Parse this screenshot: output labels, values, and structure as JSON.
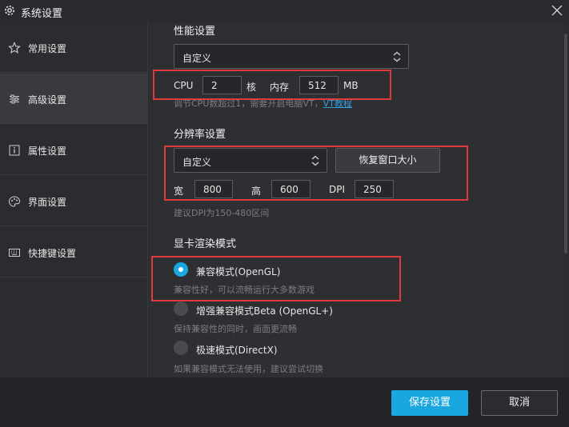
{
  "window": {
    "title": "系统设置"
  },
  "sidebar": {
    "items": [
      {
        "label": "常用设置",
        "icon": "star-icon"
      },
      {
        "label": "高级设置",
        "icon": "sliders-icon",
        "active": true
      },
      {
        "label": "属性设置",
        "icon": "info-icon"
      },
      {
        "label": "界面设置",
        "icon": "palette-icon"
      },
      {
        "label": "快捷键设置",
        "icon": "keyboard-icon"
      }
    ]
  },
  "performance": {
    "title": "性能设置",
    "mode": "自定义",
    "cpu_label": "CPU",
    "cpu_value": "2",
    "cpu_unit": "核",
    "mem_label": "内存",
    "mem_value": "512",
    "mem_unit": "MB",
    "hint": "调节CPU数超过1，需要开启电脑VT，",
    "hint_link": "VT教程"
  },
  "resolution": {
    "title": "分辨率设置",
    "mode": "自定义",
    "reset_button": "恢复窗口大小",
    "width_label": "宽",
    "width_value": "800",
    "height_label": "高",
    "height_value": "600",
    "dpi_label": "DPI",
    "dpi_value": "250",
    "hint": "建议DPI为150-480区间"
  },
  "render": {
    "title": "显卡渲染模式",
    "options": [
      {
        "label": "兼容模式(OpenGL)",
        "desc": "兼容性好，可以流畅运行大多数游戏",
        "selected": true
      },
      {
        "label": "增强兼容模式Beta (OpenGL+)",
        "desc": "保持兼容性的同时，画面更流畅",
        "selected": false
      },
      {
        "label": "极速模式(DirectX)",
        "desc": "如果兼容模式无法使用，建议尝试切换",
        "selected": false
      }
    ]
  },
  "footer": {
    "save": "保存设置",
    "cancel": "取消"
  },
  "colors": {
    "accent": "#1aa7e0",
    "highlight_box": "#e03a3a",
    "background": "#2e2f33",
    "sidebar_active": "#393a3e"
  }
}
